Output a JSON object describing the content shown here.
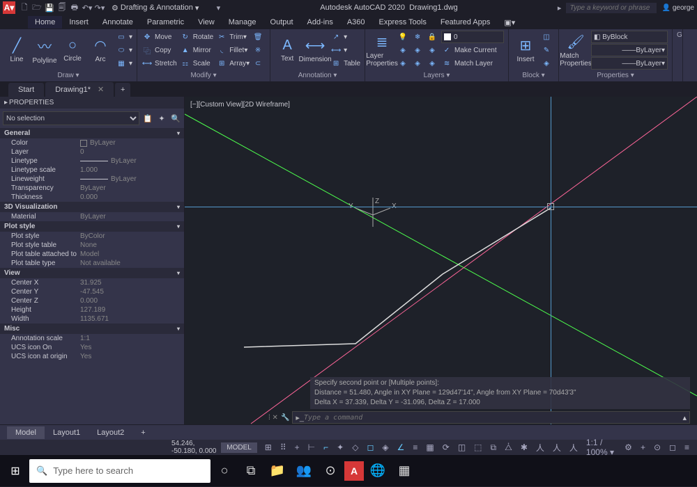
{
  "title": {
    "app": "Autodesk AutoCAD 2020",
    "file": "Drawing1.dwg"
  },
  "search_placeholder": "Type a keyword or phrase",
  "user": "george",
  "workspace": "Drafting & Annotation",
  "menu": {
    "items": [
      "Home",
      "Insert",
      "Annotate",
      "Parametric",
      "View",
      "Manage",
      "Output",
      "Add-ins",
      "A360",
      "Express Tools",
      "Featured Apps"
    ],
    "active": "Home"
  },
  "ribbon": {
    "draw": {
      "title": "Draw ▾",
      "line": "Line",
      "polyline": "Polyline",
      "circle": "Circle",
      "arc": "Arc"
    },
    "modify": {
      "title": "Modify ▾",
      "move": "Move",
      "copy": "Copy",
      "stretch": "Stretch",
      "rotate": "Rotate",
      "mirror": "Mirror",
      "scale": "Scale",
      "trim": "Trim",
      "fillet": "Fillet",
      "array": "Array"
    },
    "annotation": {
      "title": "Annotation ▾",
      "text": "Text",
      "dimension": "Dimension",
      "table": "Table"
    },
    "layers": {
      "title": "Layers ▾",
      "props": "Layer\nProperties",
      "current": "0",
      "make_current": "Make Current",
      "match": "Match Layer"
    },
    "block": {
      "title": "Block ▾",
      "insert": "Insert"
    },
    "properties": {
      "title": "Properties ▾",
      "match": "Match\nProperties",
      "byblock": "ByBlock",
      "bylayer": "ByLayer"
    }
  },
  "tabs": {
    "start": "Start",
    "drawing": "Drawing1*"
  },
  "props": {
    "title": "PROPERTIES",
    "selection": "No selection",
    "general": {
      "h": "General",
      "color": "Color",
      "color_v": "ByLayer",
      "layer": "Layer",
      "layer_v": "0",
      "linetype": "Linetype",
      "linetype_v": "ByLayer",
      "ltscale": "Linetype scale",
      "ltscale_v": "1.000",
      "lw": "Lineweight",
      "lw_v": "ByLayer",
      "trans": "Transparency",
      "trans_v": "ByLayer",
      "thick": "Thickness",
      "thick_v": "0.000"
    },
    "viz": {
      "h": "3D Visualization",
      "mat": "Material",
      "mat_v": "ByLayer"
    },
    "plot": {
      "h": "Plot style",
      "ps": "Plot style",
      "ps_v": "ByColor",
      "pst": "Plot style table",
      "pst_v": "None",
      "pta": "Plot table attached to",
      "pta_v": "Model",
      "ptt": "Plot table type",
      "ptt_v": "Not available"
    },
    "view": {
      "h": "View",
      "cx": "Center X",
      "cx_v": "31.925",
      "cy": "Center Y",
      "cy_v": "-47.545",
      "cz": "Center Z",
      "cz_v": "0.000",
      "ht": "Height",
      "ht_v": "127.189",
      "wd": "Width",
      "wd_v": "1135.671"
    },
    "misc": {
      "h": "Misc",
      "as": "Annotation scale",
      "as_v": "1:1",
      "ui": "UCS icon On",
      "ui_v": "Yes",
      "uo": "UCS icon at origin",
      "uo_v": "Yes"
    }
  },
  "canvas": {
    "view_label": "[−][Custom View][2D Wireframe]",
    "cmd1": "Specify second point or [Multiple points]:",
    "cmd2": "Distance = 51.480,  Angle in XY Plane = 129d47'14\",  Angle from XY Plane = 70d43'3\"",
    "cmd3": "Delta X = 37.339,  Delta Y = -31.096,  Delta Z = 17.000",
    "cmd_placeholder": "Type a command"
  },
  "layout": {
    "model": "Model",
    "l1": "Layout1",
    "l2": "Layout2"
  },
  "status": {
    "coords": "54.246, -50.180, 0.000",
    "model": "MODEL",
    "scale": "1:1 / 100% ▾"
  },
  "taskbar": {
    "search": "Type here to search"
  }
}
